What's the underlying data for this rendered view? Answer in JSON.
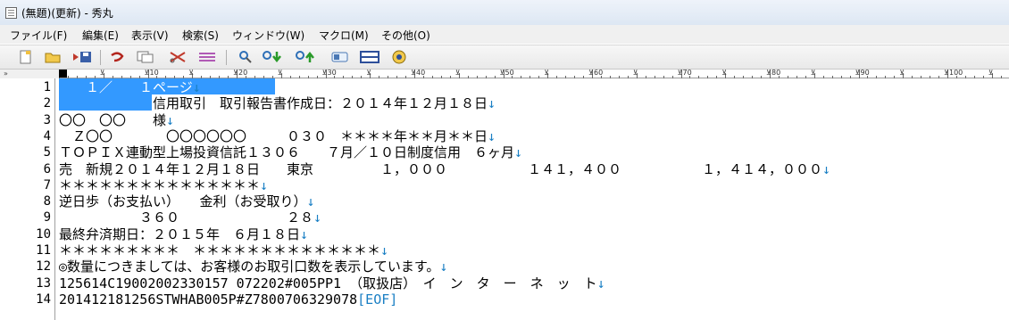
{
  "window": {
    "title": "(無題)(更新) - 秀丸"
  },
  "menu": [
    "ファイル(F)",
    "編集(E)",
    "表示(V)",
    "検索(S)",
    "ウィンドウ(W)",
    "マクロ(M)",
    "その他(O)"
  ],
  "toolbar_icons": [
    "new-file-icon",
    "open-folder-icon",
    "save-icon",
    "undo-icon",
    "copy-icon",
    "cut-icon",
    "paste-icon",
    "find-icon",
    "find-next-icon",
    "find-prev-icon",
    "grep-icon",
    "split-window-icon",
    "macro-icon"
  ],
  "ruler": {
    "labels": [
      "10",
      "20",
      "30",
      "40",
      "50",
      "60",
      "70",
      "80",
      "90",
      "100"
    ]
  },
  "editor": {
    "line_numbers": [
      "1",
      "2",
      "3",
      "4",
      "5",
      "6",
      "7",
      "8",
      "9",
      "10",
      "11",
      "12",
      "13",
      "14"
    ],
    "lines": [
      {
        "text": "　　１／　　１ページ",
        "end": "↓"
      },
      {
        "text": "　　　　　　　信用取引　取引報告書作成日：２０１４年１２月１８日",
        "end": "↓"
      },
      {
        "text": "〇〇　〇〇　　様",
        "end": "↓"
      },
      {
        "text": "　Ｚ〇〇　　　　〇〇〇〇〇〇　　　０３０　＊＊＊＊年＊＊月＊＊日",
        "end": "↓"
      },
      {
        "text": "ＴＯＰＩＸ連動型上場投資信託１３０６　　７月／１０日制度信用　６ヶ月",
        "end": "↓"
      },
      {
        "text": "売　新規２０１４年１２月１８日　　東京　　　　　１，０００　　　　　　１４１，４００　　　　　　１，４１４，０００",
        "end": "↓"
      },
      {
        "text": "＊＊＊＊＊＊＊＊＊＊＊＊＊＊＊",
        "end": "↓"
      },
      {
        "text": "逆日歩（お支払い）　　金利（お受取り）",
        "end": "↓"
      },
      {
        "text": "　　　　　　３６０　　　　　　　　２８",
        "end": "↓"
      },
      {
        "text": "最終弁済期日：２０１５年　６月１８日",
        "end": "↓"
      },
      {
        "text": "＊＊＊＊＊＊＊＊＊　＊＊＊＊＊＊＊＊＊＊＊＊＊＊",
        "end": "↓"
      },
      {
        "text": "◎数量につきましては、お客様のお取引口数を表示しています。",
        "end": "↓"
      },
      {
        "text": "125614C19002002330157 072202#005PP1 （取扱店）　イ　ン　タ　ー　ネ　ッ　ト",
        "end": "↓"
      },
      {
        "text": "201412181256STWHAB005P#Z7800706329078",
        "end": "[EOF]"
      }
    ]
  },
  "colors": {
    "selection": "#3399ff",
    "newline_mark": "#1a7fc4",
    "eof_mark": "#1a7fc4"
  }
}
